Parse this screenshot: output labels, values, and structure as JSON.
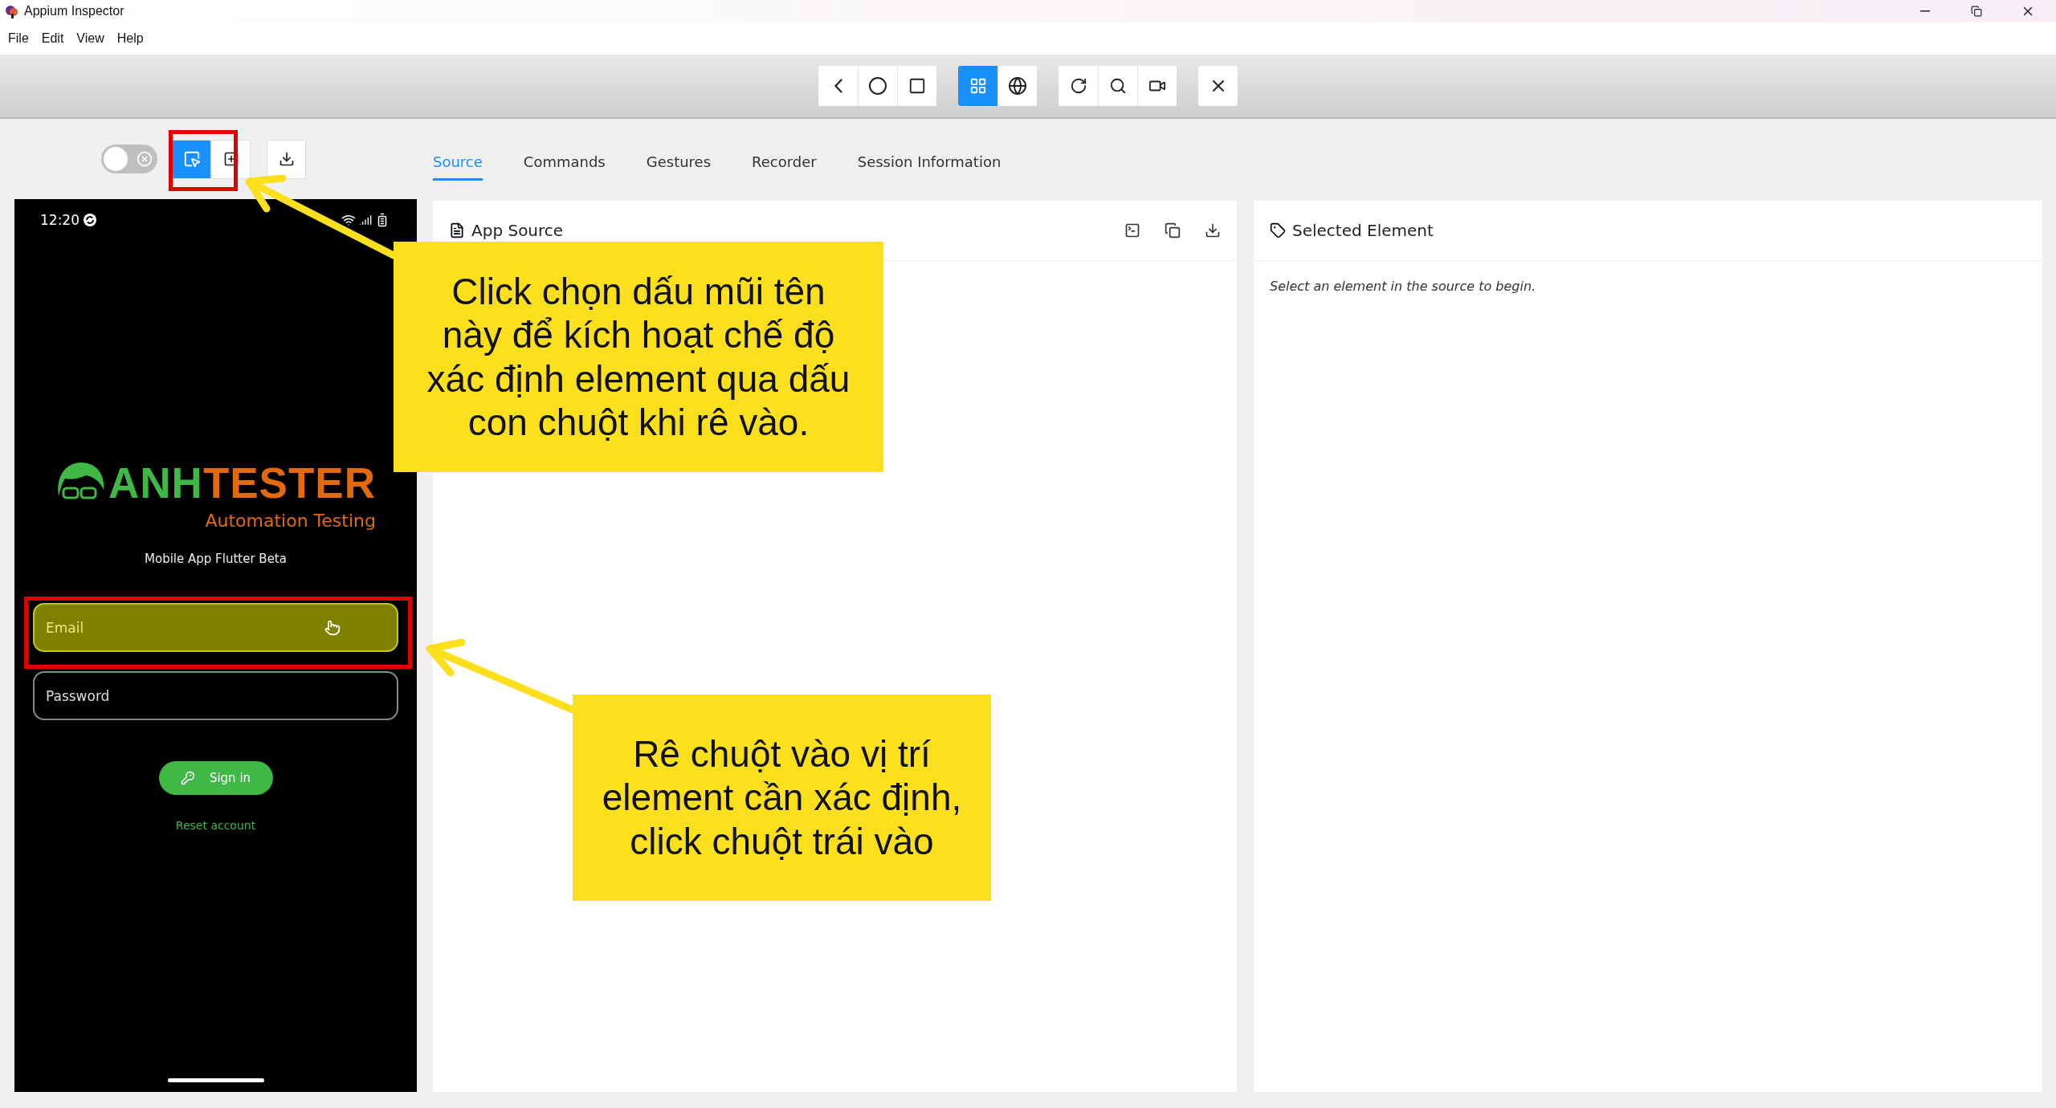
{
  "window": {
    "title": "Appium Inspector"
  },
  "menu": [
    "File",
    "Edit",
    "View",
    "Help"
  ],
  "device_toolbar": {
    "view_modes": [
      {
        "kind": "native",
        "selected": true
      },
      {
        "kind": "web",
        "selected": false
      }
    ]
  },
  "screenshot_tools": {
    "toggle": {
      "on": false
    },
    "tools": [
      {
        "kind": "select",
        "selected": true
      },
      {
        "kind": "tap",
        "selected": false
      }
    ]
  },
  "tabs": [
    {
      "label": "Source",
      "selected": true
    },
    {
      "label": "Commands",
      "selected": false
    },
    {
      "label": "Gestures",
      "selected": false
    },
    {
      "label": "Recorder",
      "selected": false
    },
    {
      "label": "Session Information",
      "selected": false
    }
  ],
  "device_screen": {
    "time": "12:20",
    "logo": [
      {
        "text": "ANH",
        "color": "#3fb846"
      },
      {
        "text": "TESTER",
        "color": "#e3690f"
      }
    ],
    "tagline": "Automation Testing",
    "subtitle": "Mobile App Flutter Beta",
    "fields": [
      {
        "placeholder": "Email",
        "highlighted": true
      },
      {
        "placeholder": "Password",
        "highlighted": false
      }
    ],
    "sign_in": "Sign in",
    "reset": "Reset account"
  },
  "app_source": {
    "title": "App Source"
  },
  "selected_element": {
    "title": "Selected Element",
    "hint": "Select an element in the source to begin."
  },
  "annotations": [
    {
      "kind": "callout",
      "text": "Click chọn dấu mũi tên này để kích hoạt chế độ xác định element qua dấu con chuột khi rê vào."
    },
    {
      "kind": "callout",
      "text": "Rê chuột vào vị trí element cần xác định, click chuột trái vào"
    }
  ]
}
